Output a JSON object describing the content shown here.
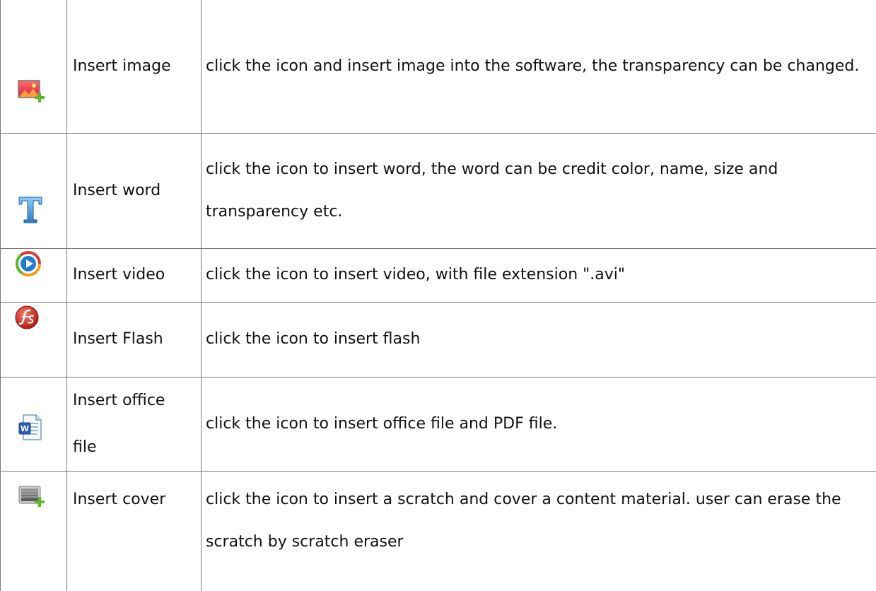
{
  "rows": [
    {
      "icon": "insert-image-icon",
      "name": "Insert image",
      "description": "click the icon and insert image into the software, the transparency can be changed."
    },
    {
      "icon": "text-t-icon",
      "name": "Insert word",
      "description": "click the icon to insert word, the word can be credit color, name, size and transparency etc."
    },
    {
      "icon": "video-play-icon",
      "name": "Insert video",
      "description": "click the icon to insert video, with file extension \".avi\""
    },
    {
      "icon": "flash-icon",
      "name": "Insert Flash",
      "description": "click the icon to insert flash"
    },
    {
      "icon": "office-document-icon",
      "name": "Insert office file",
      "description": "click the icon to insert office file and PDF file."
    },
    {
      "icon": "insert-cover-icon",
      "name": "Insert cover",
      "description": "click the icon to insert a scratch and cover a content material. user can erase the scratch by scratch eraser"
    }
  ],
  "colors": {
    "border": "#7a7a7a",
    "text": "#111111",
    "word_icon_blue": "#3a8fd8",
    "video_icon_blue": "#1e7fd0",
    "flash_icon_red": "#c0281e",
    "office_icon_blue": "#2b5fb3",
    "plus_green": "#5cb82a"
  }
}
